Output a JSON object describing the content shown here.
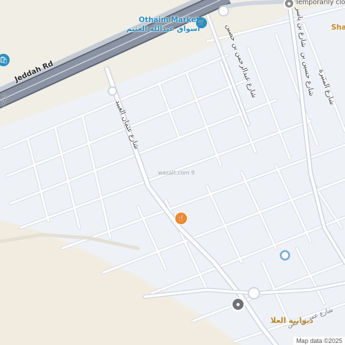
{
  "map": {
    "colors": {
      "land": "#f1eee6",
      "block": "#eef1f6",
      "road": "#ffffff",
      "road_outline": "#d3d8e2",
      "highway": "#8a93a3",
      "highway_edge": "#5d6573",
      "poi_blue": "#2d8fbf",
      "poi_orange": "#f0862b",
      "gold": "#b7892b"
    },
    "labels": {
      "highway": "Jeddah Rd",
      "poi_market_en": "Othaim Markets",
      "poi_market_ar": "أسواق عبدالله العثيم",
      "poi_top_right_en": "Temporarily closed",
      "poi_right_en": "Shaw",
      "street_1": "شارع عثمان العبيد",
      "street_2": "شارع عبدالرحمن بن حصين",
      "street_3": "شارع حسين بن",
      "street_4": "شارع المثيرة",
      "street_5": "شارع بن ياسر",
      "street_6": "شارع عمر بن معن",
      "faint_label": "wasalt.com 9",
      "place_gold": "ديوانية العلا",
      "left_edge": "الحر"
    },
    "icons": {
      "market": "shopping-cart-icon",
      "left_poi": "shopping-icon",
      "top_right": "location-pin-icon",
      "orange": "food-icon",
      "grey": "place-dot-icon"
    },
    "attribution": "Map data ©2025"
  }
}
